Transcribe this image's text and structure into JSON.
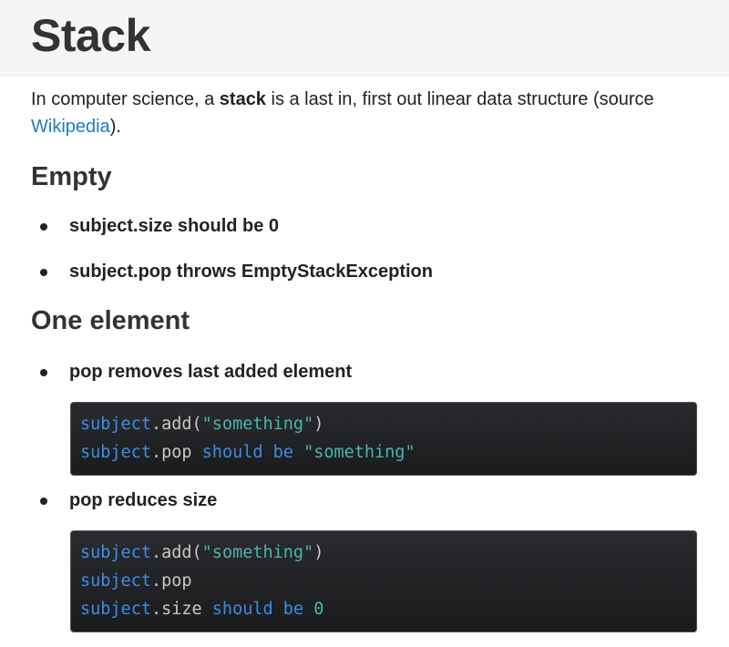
{
  "title": "Stack",
  "intro": {
    "before": "In computer science, a ",
    "bold": "stack",
    "after": " is a last in, first out linear data structure (source ",
    "link": "Wikipedia",
    "end": ")."
  },
  "sections": {
    "empty": {
      "heading": "Empty",
      "items": [
        "subject.size should be 0",
        "subject.pop throws EmptyStackException"
      ]
    },
    "one_element": {
      "heading": "One element",
      "items": [
        "pop removes last added element",
        "pop reduces size"
      ],
      "code1": {
        "l1": {
          "a": "subject",
          "b": ".add(",
          "c": "\"something\"",
          "d": ")"
        },
        "l2": {
          "a": "subject",
          "b": ".pop ",
          "c": "should be",
          "d": " ",
          "e": "\"something\""
        }
      },
      "code2": {
        "l1": {
          "a": "subject",
          "b": ".add(",
          "c": "\"something\"",
          "d": ")"
        },
        "l2": {
          "a": "subject",
          "b": ".pop"
        },
        "l3": {
          "a": "subject",
          "b": ".size ",
          "c": "should be",
          "d": " ",
          "e": "0"
        }
      }
    }
  },
  "colors": {
    "link": "#1f7bbf",
    "code_bg": "#1f2022",
    "code_identifier": "#3b8ee8",
    "code_string": "#4ab5b0",
    "header_band": "#f5f5f5"
  }
}
